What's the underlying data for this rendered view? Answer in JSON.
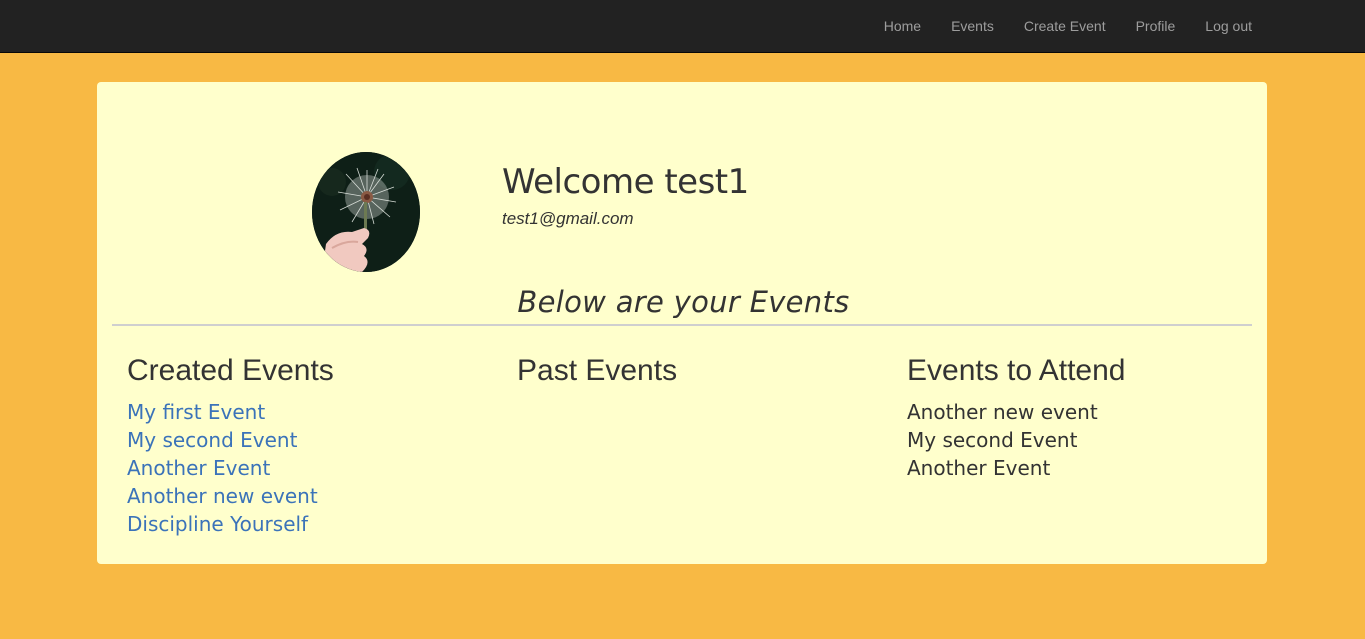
{
  "nav": {
    "items": [
      {
        "label": "Home"
      },
      {
        "label": "Events"
      },
      {
        "label": "Create Event"
      },
      {
        "label": "Profile"
      },
      {
        "label": "Log out"
      }
    ]
  },
  "profile": {
    "welcome": "Welcome test1",
    "email": "test1@gmail.com"
  },
  "events_heading": "Below are your Events",
  "columns": {
    "created": {
      "title": "Created Events",
      "items": [
        "My first Event",
        "My second Event",
        "Another Event",
        "Another new event",
        "Discipline Yourself"
      ]
    },
    "past": {
      "title": "Past Events",
      "items": []
    },
    "attend": {
      "title": "Events to Attend",
      "items": [
        "Another new event",
        "My second Event",
        "Another Event"
      ]
    }
  },
  "colors": {
    "background": "#f8b944",
    "navbar": "#222222",
    "card": "#ffffcc",
    "link": "#3b73b9"
  }
}
